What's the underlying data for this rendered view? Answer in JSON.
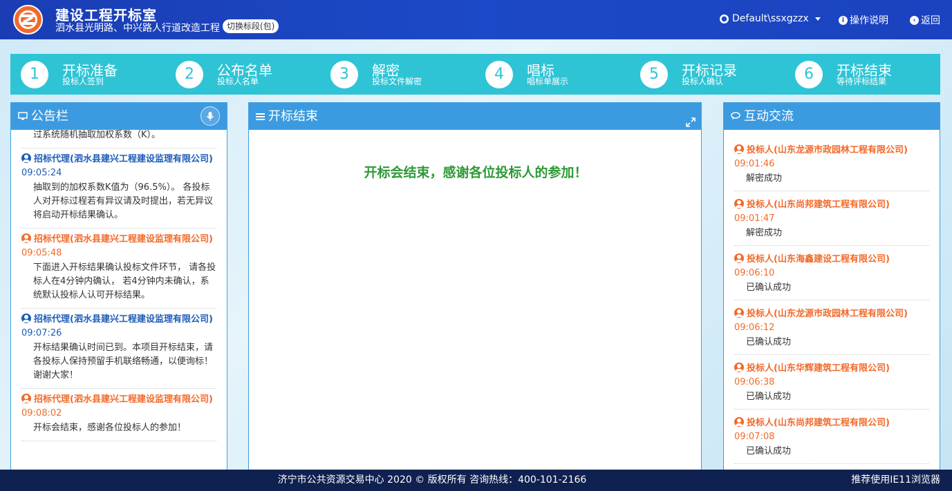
{
  "header": {
    "app_title": "建设工程开标室",
    "project_name": "泗水县光明路、中兴路人行道改造工程",
    "switch_label": "切换标段(包)",
    "user_label": "Default\\ssxgzzx",
    "help_label": "操作说明",
    "back_label": "返回"
  },
  "steps": [
    {
      "num": "1",
      "title": "开标准备",
      "sub": "投标人签到"
    },
    {
      "num": "2",
      "title": "公布名单",
      "sub": "投标人名单"
    },
    {
      "num": "3",
      "title": "解密",
      "sub": "投标文件解密"
    },
    {
      "num": "4",
      "title": "唱标",
      "sub": "唱标单展示"
    },
    {
      "num": "5",
      "title": "开标记录",
      "sub": "投标人确认"
    },
    {
      "num": "6",
      "title": "开标结束",
      "sub": "等待评标结果"
    }
  ],
  "notice": {
    "title": "公告栏",
    "partial_text": "过系统随机抽取加权系数（K）。",
    "items": [
      {
        "color": "blue",
        "sender": "招标代理(泗水县建兴工程建设监理有限公司)",
        "time": "09:05:24",
        "text": "抽取到的加权系数K值为（96.5%）。 各投标人对开标过程若有异议请及时提出，若无异议将启动开标结果确认。"
      },
      {
        "color": "orange",
        "sender": "招标代理(泗水县建兴工程建设监理有限公司)",
        "time": "09:05:48",
        "text": "下面进入开标结果确认投标文件环节， 请各投标人在4分钟内确认， 若4分钟内未确认，系统默认投标人认可开标结果。"
      },
      {
        "color": "blue",
        "sender": "招标代理(泗水县建兴工程建设监理有限公司)",
        "time": "09:07:26",
        "text": "开标结果确认时间已到。本项目开标结束，请各投标人保持预留手机联络畅通，以便询标！谢谢大家！"
      },
      {
        "color": "orange",
        "sender": "招标代理(泗水县建兴工程建设监理有限公司)",
        "time": "09:08:02",
        "text": "开标会结束，感谢各位投标人的参加！"
      }
    ]
  },
  "main": {
    "title": "开标结束",
    "message": "开标会结束，感谢各位投标人的参加！"
  },
  "chat": {
    "title": "互动交流",
    "items": [
      {
        "sender": "投标人(山东龙源市政园林工程有限公司)",
        "time": "09:01:46",
        "text": "解密成功"
      },
      {
        "sender": "投标人(山东尚邦建筑工程有限公司)",
        "time": "09:01:47",
        "text": "解密成功"
      },
      {
        "sender": "投标人(山东海鑫建设工程有限公司)",
        "time": "09:06:10",
        "text": "已确认成功"
      },
      {
        "sender": "投标人(山东龙源市政园林工程有限公司)",
        "time": "09:06:12",
        "text": "已确认成功"
      },
      {
        "sender": "投标人(山东华辉建筑工程有限公司)",
        "time": "09:06:38",
        "text": "已确认成功"
      },
      {
        "sender": "投标人(山东尚邦建筑工程有限公司)",
        "time": "09:07:08",
        "text": "已确认成功"
      }
    ]
  },
  "footer": {
    "copyright": "济宁市公共资源交易中心 2020 © 版权所有 咨询热线：400-101-2166",
    "browser_tip": "推荐使用IE11浏览器"
  },
  "colors": {
    "header_bg": "#1c49c7",
    "steps_bg": "#2ec4d6",
    "panel_head": "#3c9be0",
    "blue_sender": "#1e5cb8",
    "orange_sender": "#f26a2a",
    "success_green": "#2e9a36",
    "footer_bg": "#0f2150"
  }
}
